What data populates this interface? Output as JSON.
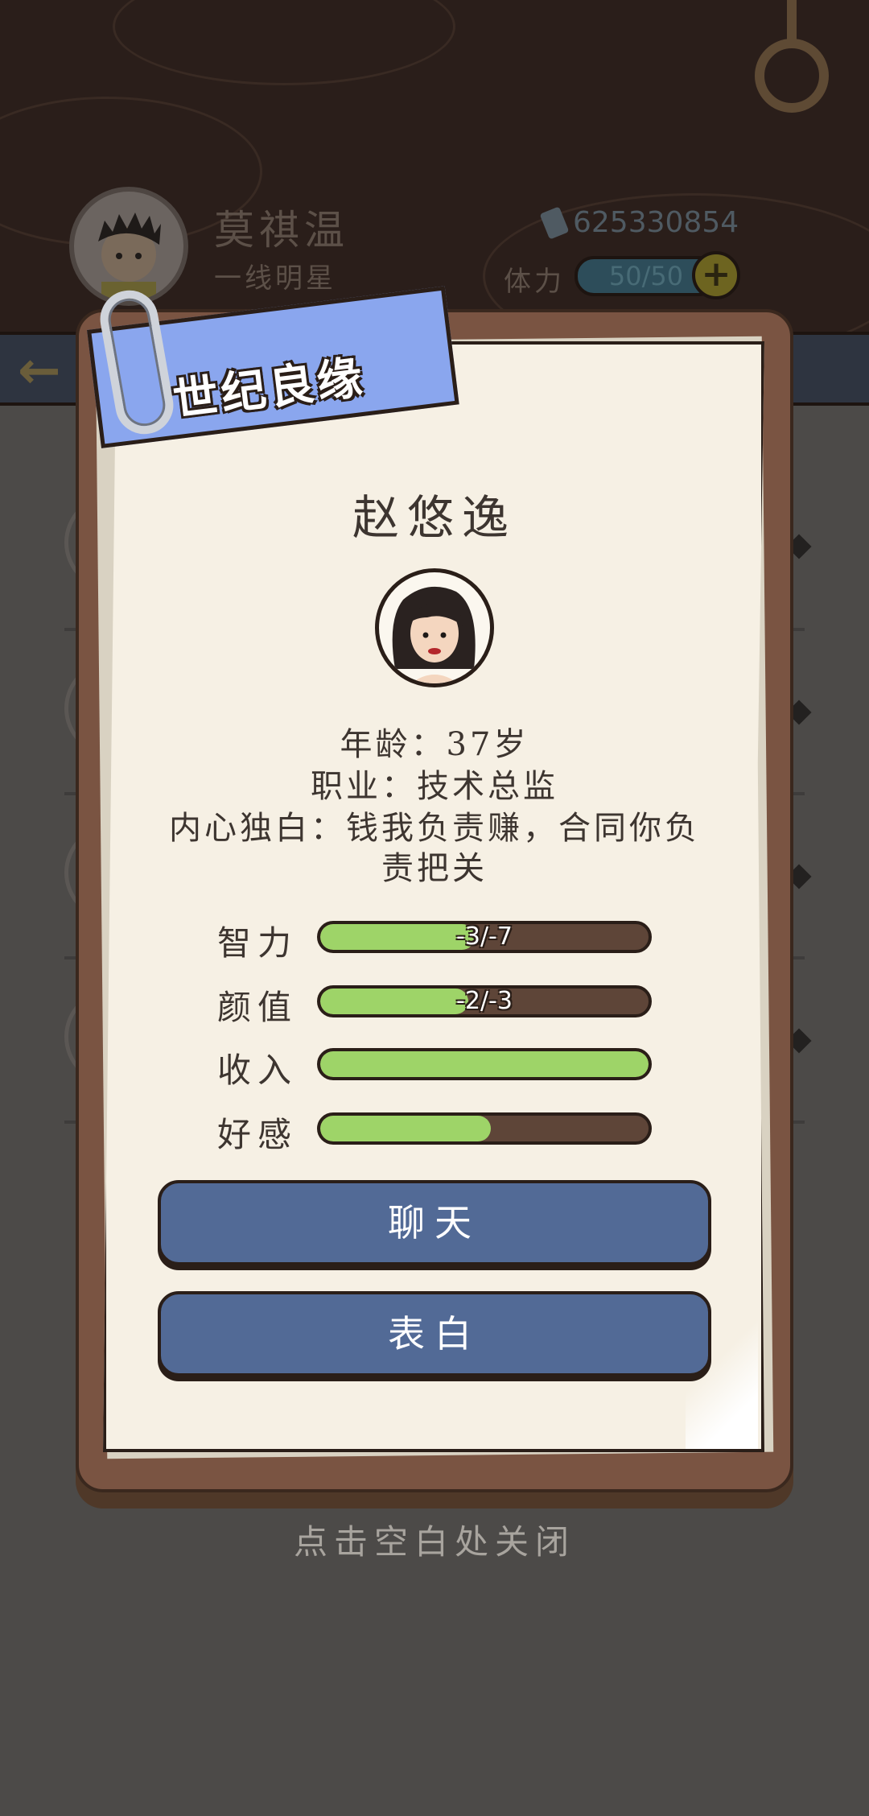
{
  "player": {
    "name": "莫祺温",
    "title": "一线明星",
    "money": "625330854",
    "stamina_label": "体力",
    "stamina_value": "50/50",
    "plus_symbol": "+"
  },
  "nav": {
    "back_symbol": "←"
  },
  "modal": {
    "banner": "世纪良缘",
    "character_name": "赵悠逸",
    "age_line": "年龄：37岁",
    "job_line": "职业：技术总监",
    "monologue_line1": "内心独白：钱我负责赚，合同你负",
    "monologue_line2": "责把关",
    "stats": [
      {
        "label": "智力",
        "fill": 0.47,
        "text": "-3/-7"
      },
      {
        "label": "颜值",
        "fill": 0.45,
        "text": "-2/-3"
      },
      {
        "label": "收入",
        "fill": 1.0,
        "text": ""
      },
      {
        "label": "好感",
        "fill": 0.52,
        "text": ""
      }
    ],
    "chat_button": "聊天",
    "confess_button": "表白",
    "close_hint": "点击空白处关闭"
  },
  "colors": {
    "bar_fill": "#9ed468",
    "button": "#526a96",
    "banner": "#8aa6ee",
    "board": "#7a5442",
    "paper": "#f6f0e4"
  }
}
